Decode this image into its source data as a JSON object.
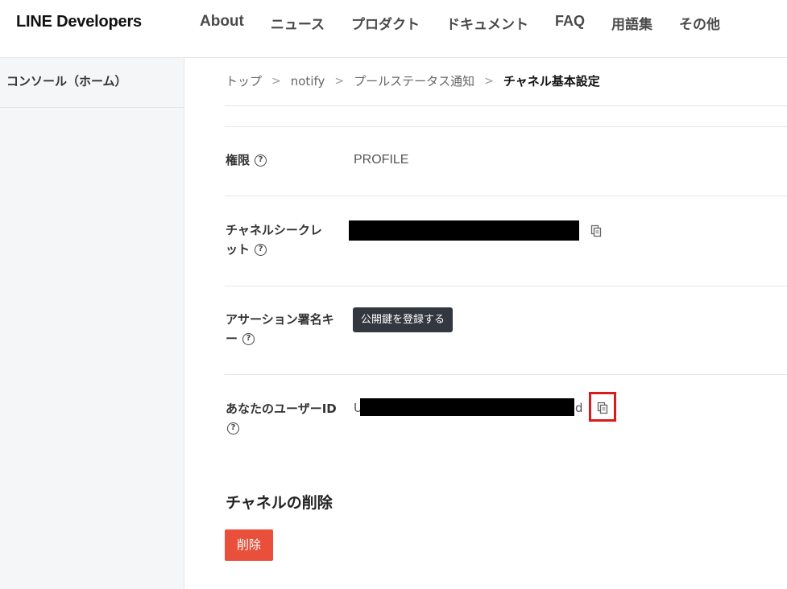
{
  "header": {
    "logo": "LINE Developers",
    "nav": [
      "About",
      "ニュース",
      "プロダクト",
      "ドキュメント",
      "FAQ",
      "用語集",
      "その他"
    ]
  },
  "sidebar": {
    "items": [
      {
        "label": "コンソール（ホーム）"
      }
    ]
  },
  "breadcrumb": [
    "トップ",
    "notify",
    "プールステータス通知",
    "チャネル基本設定"
  ],
  "breadcrumb_separator": ">",
  "fields": {
    "permission": {
      "label": "権限",
      "value": "PROFILE"
    },
    "channel_secret": {
      "label_line1": "チャネルシークレ",
      "label_line2": "ット"
    },
    "assertion_key": {
      "label_line1": "アサーション署名キ",
      "label_line2": "ー",
      "button": "公開鍵を登録する"
    },
    "user_id": {
      "label": "あなたのユーザーID",
      "value_prefix": "U",
      "value_suffix": "d"
    }
  },
  "help_glyph": "?",
  "delete_section": {
    "title": "チャネルの削除",
    "button": "削除"
  },
  "colors": {
    "delete_button": "#e9503c",
    "dark_button": "#33373f",
    "highlight": "#d91b1b",
    "sidebar_bg": "#f5f6f8"
  }
}
